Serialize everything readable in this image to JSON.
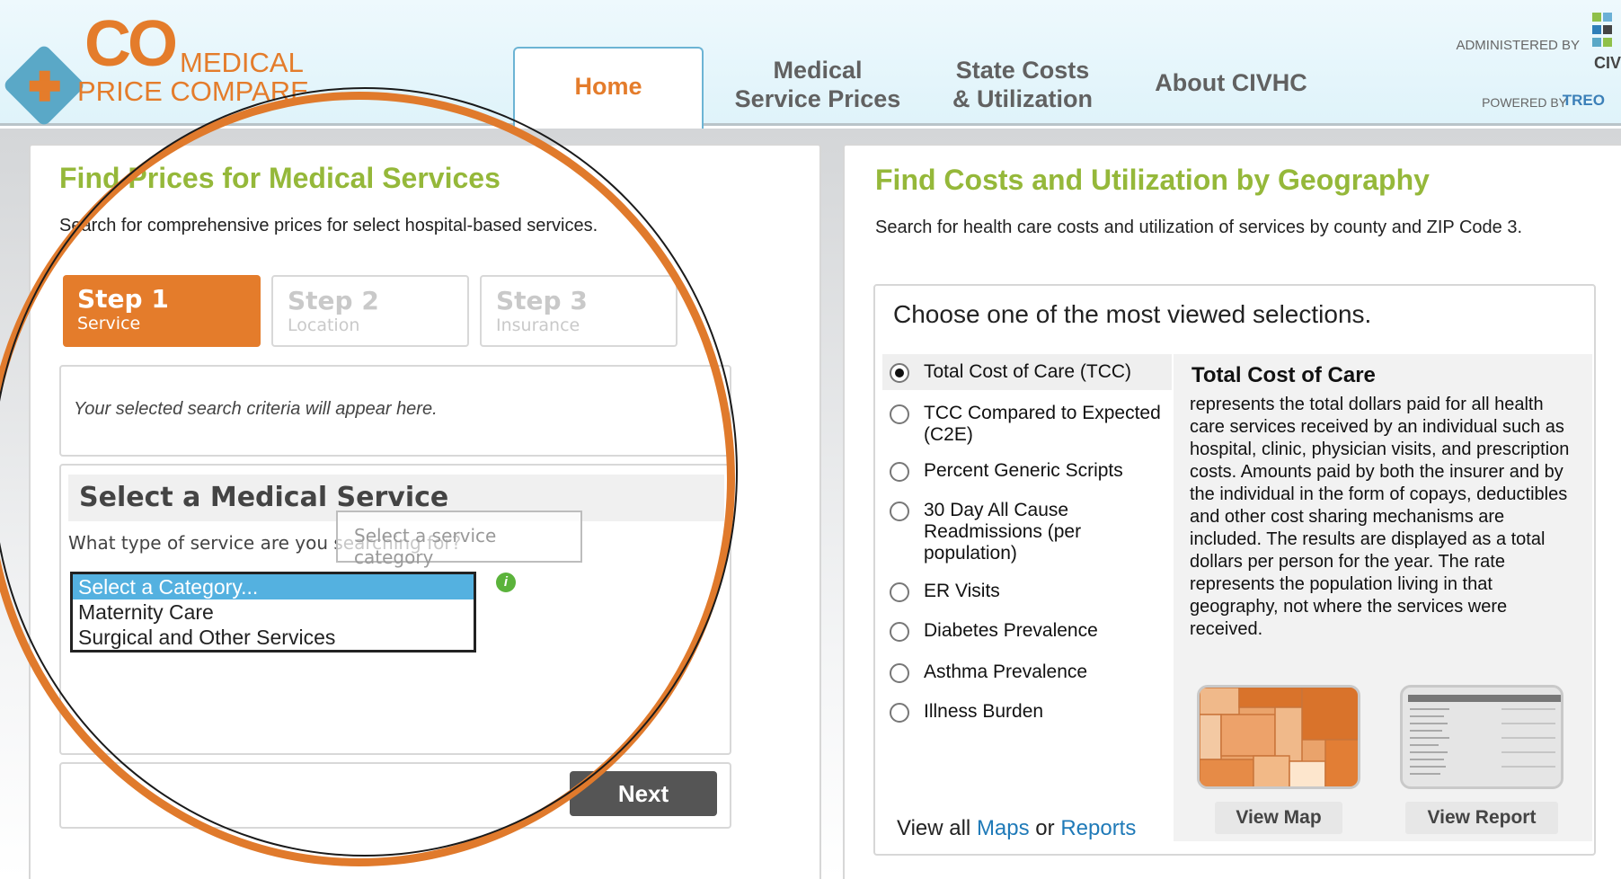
{
  "header": {
    "logo_co": "CO",
    "logo_medical": "MEDICAL",
    "logo_price": "PRICE COMPARE",
    "tabs": [
      {
        "label": "Home"
      },
      {
        "label_line1": "Medical",
        "label_line2": "Service Prices"
      },
      {
        "label_line1": "State Costs",
        "label_line2": "& Utilization"
      },
      {
        "label": "About CIVHC"
      }
    ],
    "administered": "ADMINISTERED BY",
    "civ": "CIV",
    "powered": "POWERED BY",
    "treo": "TREO"
  },
  "left": {
    "title": "Find Prices for Medical Services",
    "desc": "Search for comprehensive prices for select hospital-based services.",
    "steps": [
      {
        "num": "Step 1",
        "sub": "Service"
      },
      {
        "num": "Step 2",
        "sub": "Location"
      },
      {
        "num": "Step 3",
        "sub": "Insurance"
      }
    ],
    "criteria": "Your selected search criteria will appear here.",
    "service_title": "Select a Medical Service",
    "service_question": "What type of service are you searching for?",
    "tooltip": "Select a service category",
    "options": [
      "Select a Category...",
      "Maternity Care",
      "Surgical and Other Services"
    ],
    "next": "Next"
  },
  "right": {
    "title": "Find Costs and Utilization by Geography",
    "desc": "Search for health care costs and utilization of services by county and ZIP Code 3.",
    "choose": "Choose one of the most viewed selections.",
    "radios": [
      "Total Cost of Care (TCC)",
      "TCC Compared to Expected (C2E)",
      "Percent Generic Scripts",
      "30 Day All Cause Readmissions (per population)",
      "ER Visits",
      "Diabetes Prevalence",
      "Asthma Prevalence",
      "Illness Burden"
    ],
    "selected_index": 0,
    "tcc_title": "Total Cost of Care",
    "tcc_text": "represents the total dollars paid for all health care services received by an individual such as hospital, clinic, physician visits, and prescription costs. Amounts paid by both the insurer and by the individual in the form of copays, deductibles and other cost sharing mechanisms are included. The results are displayed as a total dollars per person for the year. The rate represents the population living in that geography, not where the services were received.",
    "view_map": "View Map",
    "view_report": "View Report",
    "view_all": "View all",
    "maps": "Maps",
    "or": "or",
    "reports": "Reports"
  },
  "colors": {
    "accent_orange": "#e47c2b",
    "title_green": "#95b83a",
    "link_blue": "#1f7ab8",
    "select_blue": "#54b1e0"
  }
}
